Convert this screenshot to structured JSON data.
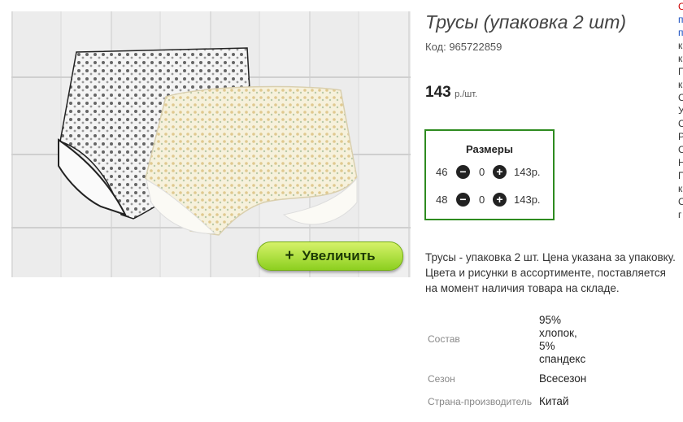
{
  "product": {
    "title": "Трусы (упаковка 2 шт)",
    "code": "Код: 965722859",
    "price": "143",
    "price_unit": "р./шт.",
    "zoom_label": "Увеличить",
    "zoom_plus": "+"
  },
  "sizes": {
    "title": "Размеры",
    "rows": [
      {
        "size": "46",
        "qty": "0",
        "price": "143р."
      },
      {
        "size": "48",
        "qty": "0",
        "price": "143р."
      }
    ]
  },
  "description": {
    "lines": [
      "Трусы - упаковка 2 шт. Цена указана за упаковку.",
      "Цвета и рисунки в ассортименте, поставляется",
      "на момент наличия товара на складе."
    ]
  },
  "specs": [
    {
      "label": "Состав",
      "value_lines": [
        "95%",
        "хлопок,",
        "5%",
        "спандекс"
      ]
    },
    {
      "label": "Сезон",
      "value_lines": [
        "Всесезон"
      ]
    },
    {
      "label": "Страна-производитель",
      "value_lines": [
        "Китай"
      ]
    }
  ],
  "sidebar_fragments": [
    "С",
    "п",
    "п",
    "к",
    "к",
    "П",
    "к",
    "С",
    "У",
    "С",
    "Р",
    "С",
    "Н",
    "П",
    "к",
    "С",
    "г"
  ],
  "colors": {
    "accent_green": "#2e8b20",
    "button_green": "#8ccf1f",
    "link_red": "#cc0000",
    "link_blue": "#1a4fc0"
  }
}
